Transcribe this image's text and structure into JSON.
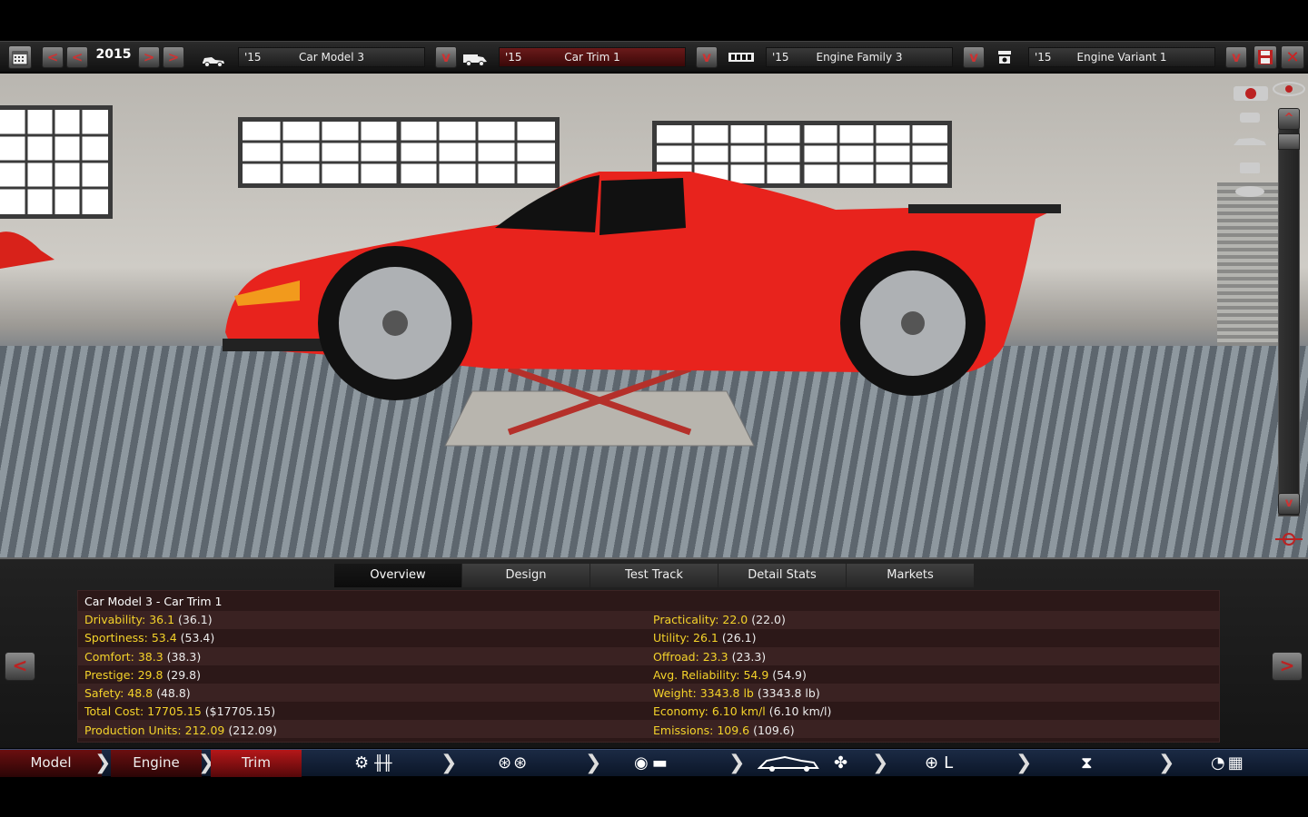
{
  "toolbar": {
    "year": "2015",
    "car_model": {
      "year": "'15",
      "name": "Car Model 3"
    },
    "car_trim": {
      "year": "'15",
      "name": "Car Trim 1"
    },
    "engine_family": {
      "year": "'15",
      "name": "Engine Family 3"
    },
    "engine_variant": {
      "year": "'15",
      "name": "Engine Variant 1"
    },
    "icons": [
      "calendar-icon",
      "prev-prev-icon",
      "prev-icon",
      "next-icon",
      "next-next-icon",
      "car-model-icon",
      "car-trim-icon",
      "engine-family-icon",
      "engine-variant-icon",
      "save-icon",
      "close-icon"
    ]
  },
  "viewport": {
    "car_color": "#e8231d",
    "side_icons": [
      "camera-icon",
      "eye-icon",
      "car-front-icon",
      "car-side-icon",
      "car-rear-icon",
      "car-top-icon"
    ]
  },
  "tabs": [
    "Overview",
    "Design",
    "Test Track",
    "Detail Stats",
    "Markets"
  ],
  "active_tab": "Overview",
  "stats": {
    "title": "Car Model 3 - Car Trim 1",
    "left": [
      {
        "label": "Drivability: 36.1",
        "prev": "(36.1)"
      },
      {
        "label": "Sportiness: 53.4",
        "prev": "(53.4)"
      },
      {
        "label": "Comfort: 38.3",
        "prev": "(38.3)"
      },
      {
        "label": "Prestige: 29.8",
        "prev": "(29.8)"
      },
      {
        "label": "Safety: 48.8",
        "prev": "(48.8)"
      },
      {
        "label": "Total Cost: 17705.15",
        "prev": "($17705.15)"
      },
      {
        "label": "Production Units: 212.09",
        "prev": "(212.09)"
      }
    ],
    "right": [
      {
        "label": "Practicality: 22.0",
        "prev": "(22.0)"
      },
      {
        "label": "Utility: 26.1",
        "prev": "(26.1)"
      },
      {
        "label": "Offroad: 23.3",
        "prev": "(23.3)"
      },
      {
        "label": "Avg. Reliability: 54.9",
        "prev": "(54.9)"
      },
      {
        "label": "Weight: 3343.8 lb",
        "prev": "(3343.8 lb)"
      },
      {
        "label": "Economy: 6.10 km/l",
        "prev": "(6.10 km/l)"
      },
      {
        "label": "Emissions: 109.6",
        "prev": "(109.6)"
      }
    ]
  },
  "steps": {
    "model": "Model",
    "engine": "Engine",
    "trim": "Trim"
  },
  "colors": {
    "stat_label": "#f4d32a",
    "accent_red": "#c0191b",
    "nav_blue": "#0b1628"
  }
}
